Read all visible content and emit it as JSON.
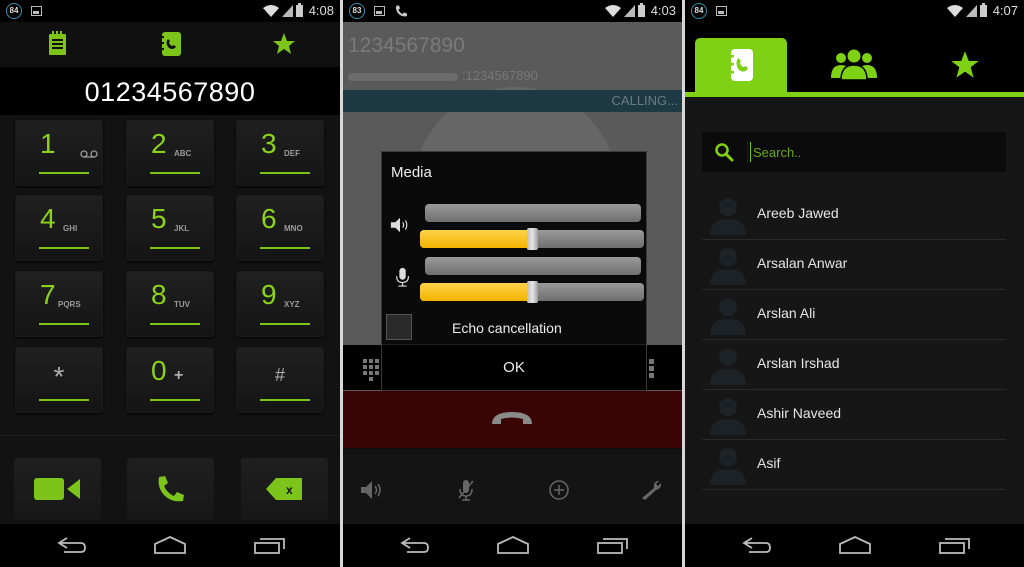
{
  "colors": {
    "accent_green": "#7ed114",
    "calling_bar": "#1c3944",
    "end_call_bg": "#3a0404",
    "slider_fill": "#f2b300"
  },
  "dialer": {
    "status": {
      "notification_count": "84",
      "time": "4:08"
    },
    "tabs": [
      {
        "icon": "call-log-icon"
      },
      {
        "icon": "contacts-book-icon"
      },
      {
        "icon": "star-icon"
      }
    ],
    "number": "01234567890",
    "keys": [
      {
        "digit": "1",
        "letters": "",
        "extra_icon": "voicemail-icon"
      },
      {
        "digit": "2",
        "letters": "ABC"
      },
      {
        "digit": "3",
        "letters": "DEF"
      },
      {
        "digit": "4",
        "letters": "GHI"
      },
      {
        "digit": "5",
        "letters": "JKL"
      },
      {
        "digit": "6",
        "letters": "MNO"
      },
      {
        "digit": "7",
        "letters": "PQRS"
      },
      {
        "digit": "8",
        "letters": "TUV"
      },
      {
        "digit": "9",
        "letters": "XYZ"
      },
      {
        "symbol": "*"
      },
      {
        "digit": "0",
        "letters": "+"
      },
      {
        "symbol": "#"
      }
    ],
    "actions": [
      {
        "icon": "video-call-icon"
      },
      {
        "icon": "call-icon"
      },
      {
        "icon": "backspace-icon"
      }
    ]
  },
  "incall": {
    "status": {
      "notification_count": "83",
      "time": "4:03"
    },
    "number": "1234567890",
    "sub_number": ":1234567890",
    "call_state": "CALLING...",
    "dialog": {
      "title": "Media",
      "speaker_volume_percent": 50,
      "mic_volume_percent": 50,
      "speaker_top_bar_percent": 0,
      "mic_top_bar_percent": 0,
      "echo_cancellation_label": "Echo cancellation",
      "echo_cancellation_checked": false,
      "ok_label": "OK"
    },
    "bottom_icons": [
      "speaker-icon",
      "mute-mic-icon",
      "add-call-icon",
      "settings-wrench-icon"
    ]
  },
  "contacts": {
    "status": {
      "notification_count": "84",
      "time": "4:07"
    },
    "tabs": [
      {
        "icon": "contacts-book-icon",
        "active": true
      },
      {
        "icon": "groups-icon",
        "active": false
      },
      {
        "icon": "favorites-star-icon",
        "active": false
      }
    ],
    "search": {
      "placeholder": "Search..",
      "value": ""
    },
    "list": [
      {
        "name": "Areeb Jawed"
      },
      {
        "name": "Arsalan Anwar"
      },
      {
        "name": "Arslan Ali"
      },
      {
        "name": "Arslan Irshad"
      },
      {
        "name": "Ashir Naveed"
      },
      {
        "name": "Asif"
      }
    ]
  }
}
